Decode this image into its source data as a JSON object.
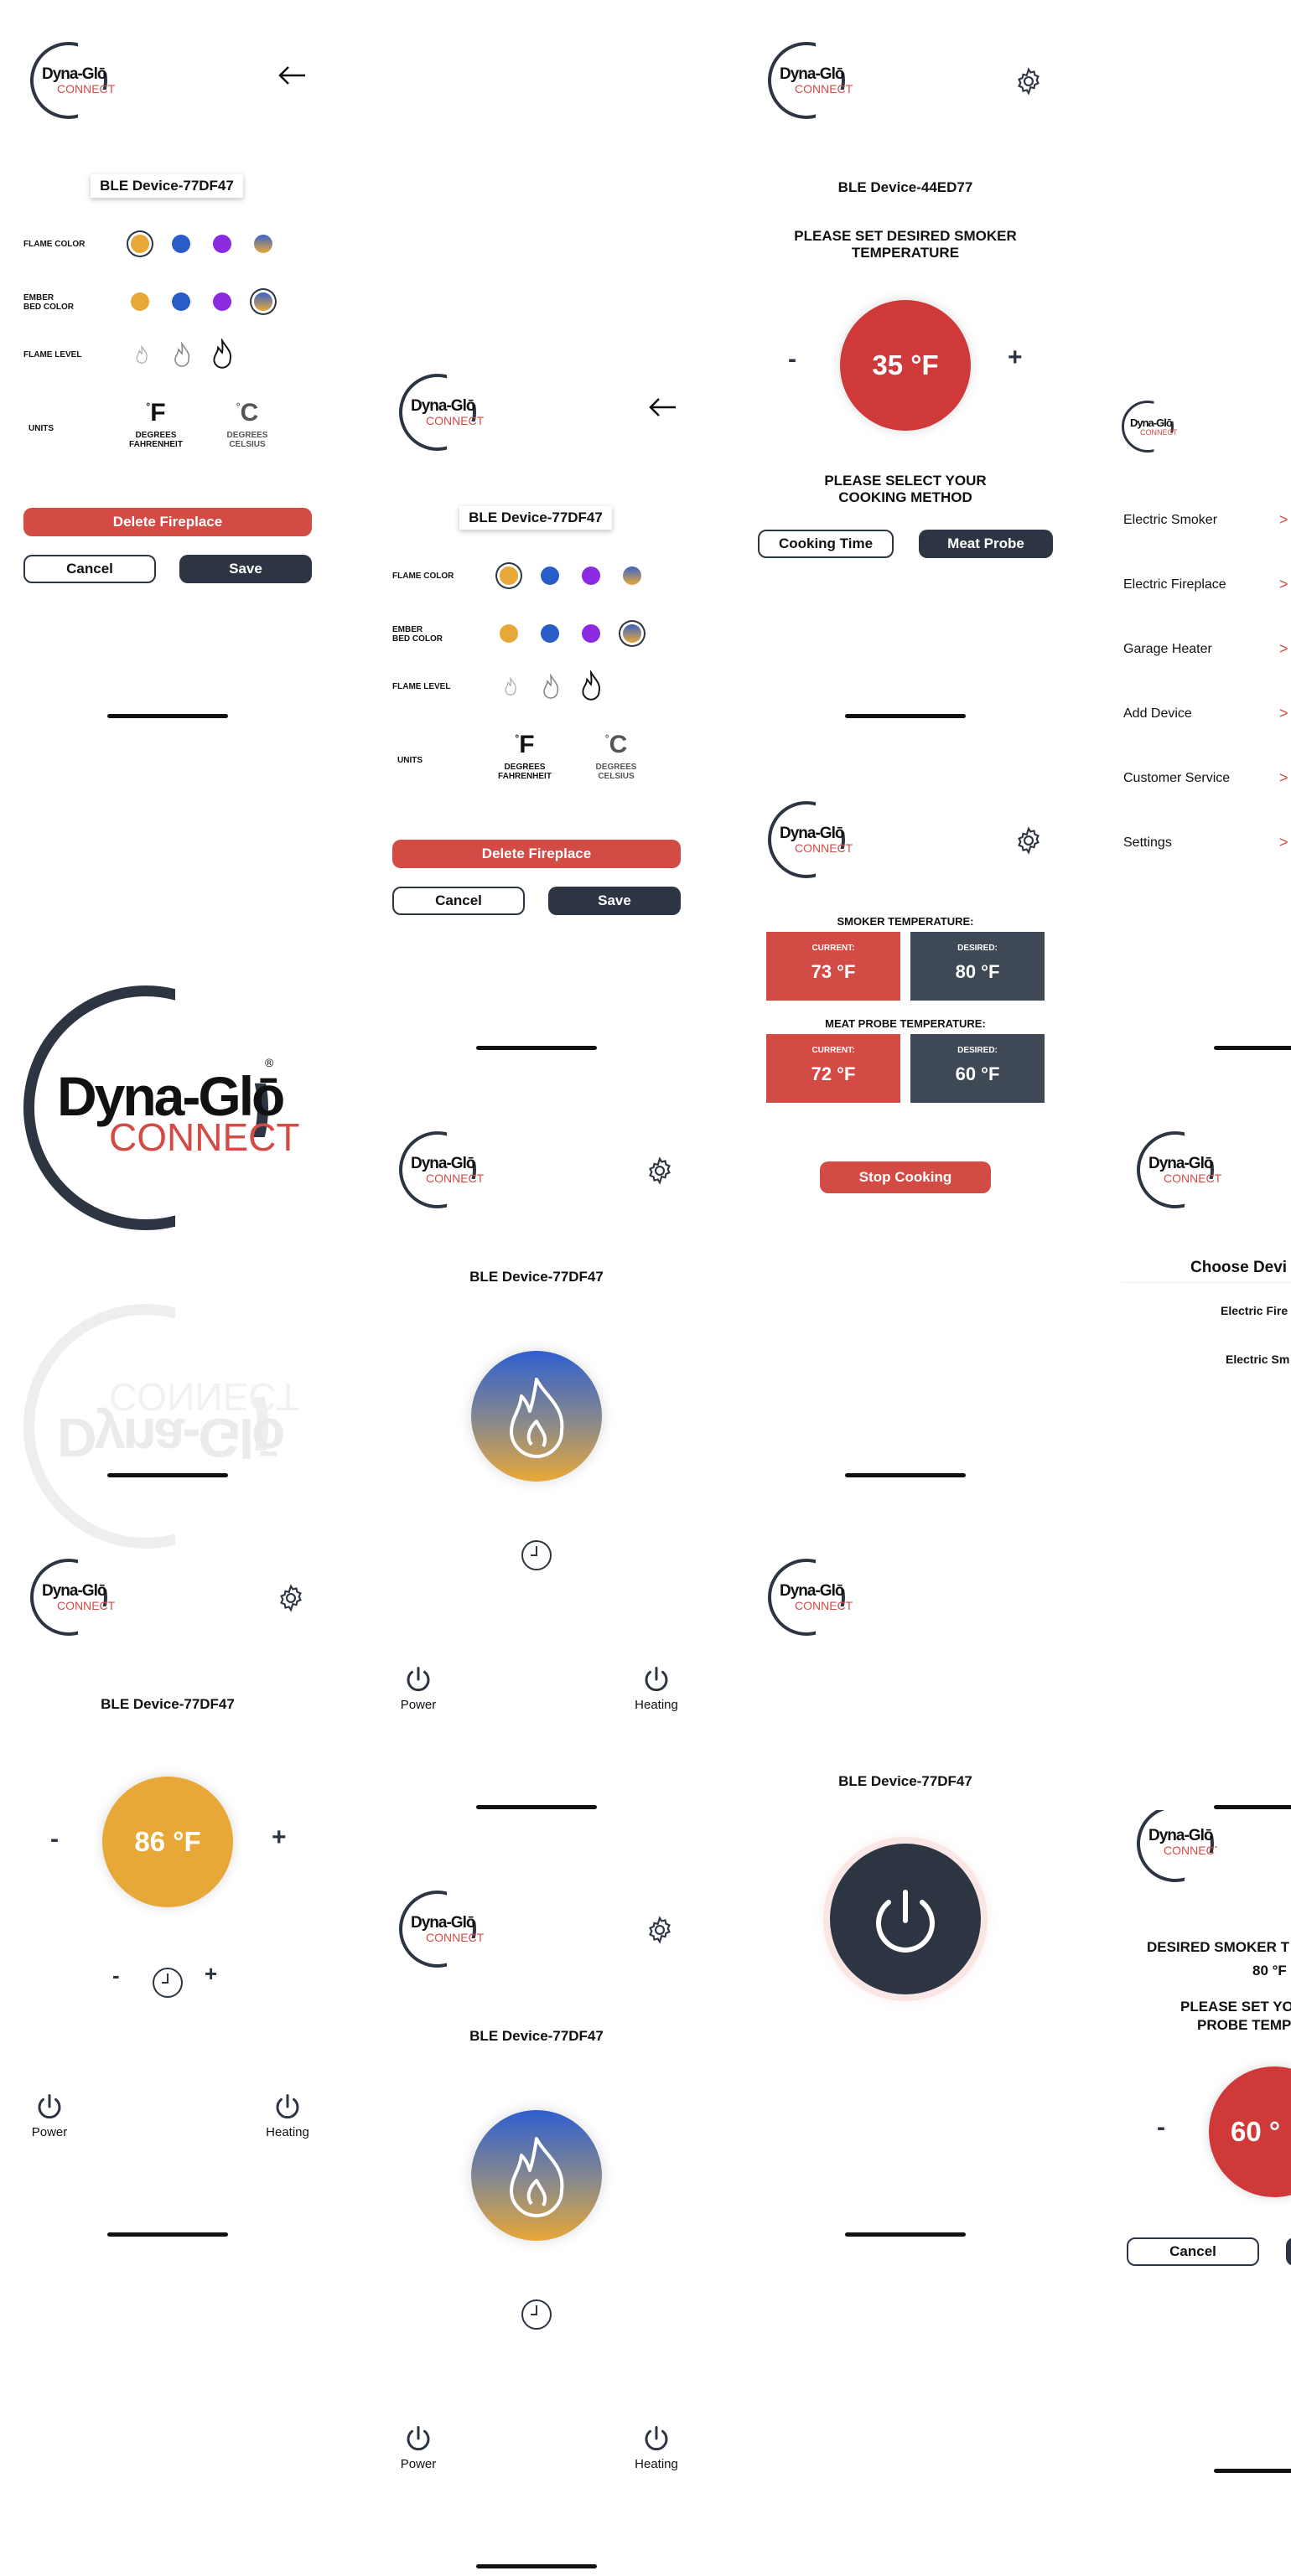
{
  "brand": {
    "word1": "Dyna-Glō",
    "word2": "CONNECT",
    "registered": "®"
  },
  "colors": {
    "red": "#d34b45",
    "dark": "#2d3542",
    "orange": "#e8a838",
    "blue": "#2a5cc9",
    "purple": "#8a2be2"
  },
  "icons": {
    "back": "arrow-left-icon",
    "settings": "gear-icon",
    "power": "power-icon",
    "heating": "heating-icon",
    "timer": "clock-icon",
    "flame": "flame-icon",
    "chevron": "chevron-right-icon"
  },
  "edit_screen": {
    "device": "BLE Device-77DF47",
    "flame_color_label": "FLAME COLOR",
    "ember_label_1": "EMBER",
    "ember_label_2": "BED COLOR",
    "flame_level_label": "FLAME LEVEL",
    "units_label": "UNITS",
    "unit_f": "F",
    "unit_c": "C",
    "deg": "°",
    "f_label_1": "DEGREES",
    "f_label_2": "FAHRENHEIT",
    "c_label_1": "DEGREES",
    "c_label_2": "CELSIUS",
    "delete": "Delete Fireplace",
    "cancel": "Cancel",
    "save": "Save"
  },
  "smoker_set": {
    "device": "BLE Device-44ED77",
    "prompt_1": "PLEASE SET DESIRED SMOKER",
    "prompt_2": "TEMPERATURE",
    "temp": "35 °F",
    "minus": "-",
    "plus": "+",
    "method_1": "PLEASE SELECT YOUR",
    "method_2": "COOKING METHOD",
    "cooking_time": "Cooking Time",
    "meat_probe": "Meat Probe"
  },
  "menu": {
    "items": [
      "Electric Smoker",
      "Electric Fireplace",
      "Garage Heater",
      "Add Device",
      "Customer Service",
      "Settings"
    ],
    "chevron": ">"
  },
  "cooking": {
    "smoker_temp_label": "SMOKER TEMPERATURE:",
    "probe_temp_label": "MEAT PROBE TEMPERATURE:",
    "current_label": "CURRENT:",
    "desired_label": "DESIRED:",
    "smoker_current": "73 °F",
    "smoker_desired": "80 °F",
    "probe_current": "72 °F",
    "probe_desired": "60 °F",
    "stop": "Stop Cooking"
  },
  "fireplace": {
    "device": "BLE Device-77DF47",
    "power": "Power",
    "heating": "Heating"
  },
  "choose_device": {
    "title": "Choose Devi",
    "item1": "Electric Fire",
    "item2": "Electric Sm"
  },
  "heater": {
    "device": "BLE Device-77DF47",
    "temp": "86 °F",
    "minus": "-",
    "plus": "+",
    "power": "Power",
    "heating": "Heating"
  },
  "power_screen": {
    "device": "BLE Device-77DF47"
  },
  "probe_set": {
    "desired_1": "DESIRED SMOKER T",
    "desired_2": "80 °F",
    "prompt_1": "PLEASE SET YO",
    "prompt_2": "PROBE TEMP",
    "temp": "60 °",
    "minus": "-",
    "cancel": "Cancel"
  }
}
